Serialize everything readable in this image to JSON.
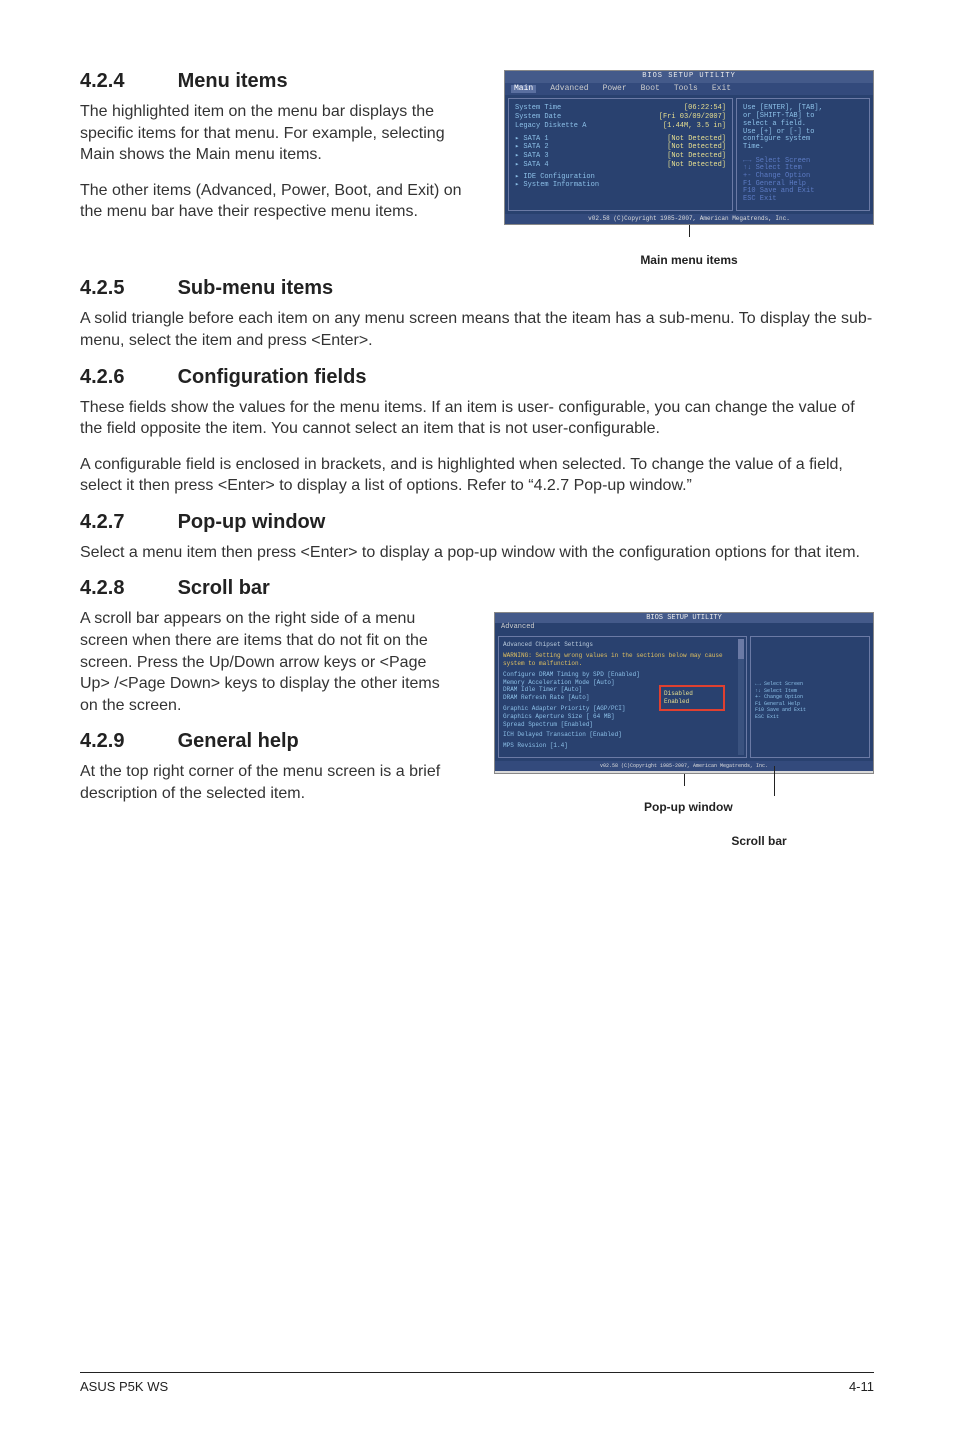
{
  "sec424": {
    "num": "4.2.4",
    "title": "Menu items",
    "p1": "The highlighted item on the menu bar displays the specific items for that menu. For example, selecting Main shows the Main menu items.",
    "p2": "The other items (Advanced, Power, Boot, and Exit) on the menu bar have their respective menu items."
  },
  "sec425": {
    "num": "4.2.5",
    "title": "Sub-menu items",
    "p1": "A solid triangle before each item on any menu screen means that the iteam has a sub-menu. To display the sub-menu, select the item and press <Enter>."
  },
  "sec426": {
    "num": "4.2.6",
    "title": "Configuration fields",
    "p1": "These fields show the values for the menu items. If an item is user- configurable, you can change the value of the field opposite the item. You cannot select an item that is not user-configurable.",
    "p2": "A configurable field is enclosed in brackets, and is highlighted when selected. To change the value of a field, select it then press <Enter> to display a list of options. Refer to “4.2.7 Pop-up window.”"
  },
  "sec427": {
    "num": "4.2.7",
    "title": "Pop-up window",
    "p1": "Select a menu item then press <Enter> to display a pop-up window with the configuration options for that item."
  },
  "sec428": {
    "num": "4.2.8",
    "title": "Scroll bar",
    "p1": "A scroll bar appears on the right side of a menu screen when there are items that do not fit on the screen. Press the Up/Down arrow keys or <Page Up> /<Page Down> keys to display the other items on the screen."
  },
  "sec429": {
    "num": "4.2.9",
    "title": "General help",
    "p1": "At the top right corner of the menu screen is a brief description of the selected item."
  },
  "bios1": {
    "top": "BIOS SETUP UTILITY",
    "menu": {
      "main": "Main",
      "adv": "Advanced",
      "power": "Power",
      "boot": "Boot",
      "tools": "Tools",
      "exit": "Exit"
    },
    "rows": {
      "time_l": "System Time",
      "time_v": "[06:22:54]",
      "date_l": "System Date",
      "date_v": "[Fri 03/09/2007]",
      "leg_l": "Legacy Diskette A",
      "leg_v": "[1.44M, 3.5 in]",
      "s1_l": "▸ SATA 1",
      "s1_v": "[Not Detected]",
      "s2_l": "▸ SATA 2",
      "s2_v": "[Not Detected]",
      "s3_l": "▸ SATA 3",
      "s3_v": "[Not Detected]",
      "s4_l": "▸ SATA 4",
      "s4_v": "[Not Detected]",
      "ide": "▸ IDE Configuration",
      "sys": "▸ System Information"
    },
    "help": {
      "h1": "Use [ENTER], [TAB],",
      "h2": "or [SHIFT-TAB] to",
      "h3": "select a field.",
      "h4": " ",
      "h5": "Use [+] or [-] to",
      "h6": "configure system",
      "h7": "Time.",
      "k1": "←→    Select Screen",
      "k2": "↑↓    Select Item",
      "k3": "+-    Change Option",
      "k4": "F1    General Help",
      "k5": "F10   Save and Exit",
      "k6": "ESC   Exit"
    },
    "footer": "v02.58 (C)Copyright 1985-2007, American Megatrends, Inc.",
    "caption": "Main menu items"
  },
  "bios2": {
    "top": "BIOS SETUP UTILITY",
    "sub": "Advanced",
    "heading": "Advanced Chipset Settings",
    "warn": "WARNING: Setting wrong values in the sections below may cause system to malfunction.",
    "lines": {
      "l1": "Configure DRAM Timing by SPD   [Enabled]",
      "l2": "Memory Acceleration Mode       [Auto]",
      "l3": "DRAM Idle Timer                [Auto]",
      "l4": "DRAM Refresh Rate              [Auto]",
      "l5": "Graphic Adapter Priority       [AGP/PCI]",
      "l6": "Graphics Aperture Size         [ 64 MB]",
      "l7": "Spread Spectrum                [Enabled]",
      "l8": "ICH Delayed Transaction        [Enabled]",
      "l9": "MPS Revision                   [1.4]"
    },
    "popup": {
      "o1": "Disabled",
      "o2": "Enabled"
    },
    "help": {
      "k1": "←→   Select Screen",
      "k2": "↑↓   Select Item",
      "k3": "+-   Change Option",
      "k4": "F1   General Help",
      "k5": "F10  Save and Exit",
      "k6": "ESC  Exit"
    },
    "footer": "v02.58 (C)Copyright 1985-2007, American Megatrends, Inc."
  },
  "captions": {
    "popup": "Pop-up window",
    "scroll": "Scroll bar"
  },
  "footer": {
    "left": "ASUS P5K WS",
    "right": "4-11"
  }
}
